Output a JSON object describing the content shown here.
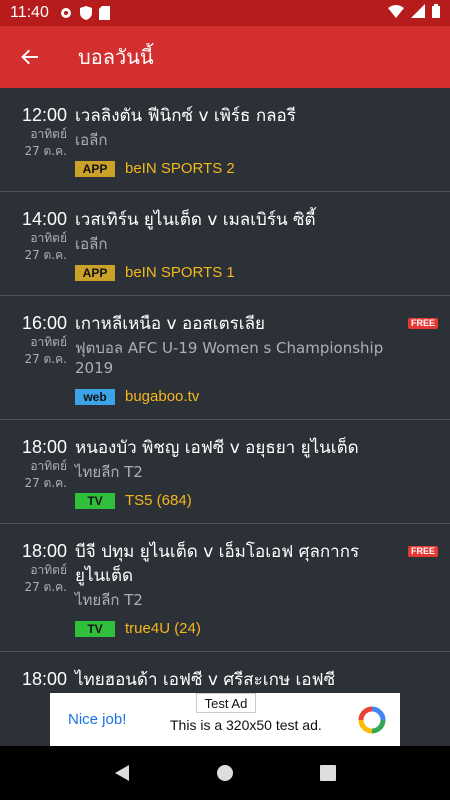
{
  "status_bar": {
    "time": "11:40"
  },
  "app_bar": {
    "title": "บอลวันนี้"
  },
  "matches": [
    {
      "hour": "12:00",
      "day": "อาทิตย์",
      "date": "27 ต.ค.",
      "teams": "เวลลิงตัน ฟีนิกซ์ v เพิร์ธ กลอรี",
      "league": "เอลีก",
      "badge": "APP",
      "badge_type": "app",
      "channel": "beIN SPORTS 2",
      "free": ""
    },
    {
      "hour": "14:00",
      "day": "อาทิตย์",
      "date": "27 ต.ค.",
      "teams": "เวสเทิร์น ยูไนเต็ด v เมลเบิร์น ซิตี้",
      "league": "เอลีก",
      "badge": "APP",
      "badge_type": "app",
      "channel": "beIN SPORTS 1",
      "free": ""
    },
    {
      "hour": "16:00",
      "day": "อาทิตย์",
      "date": "27 ต.ค.",
      "teams": "เกาหลีเหนือ v ออสเตรเลีย",
      "league": "ฟุตบอล AFC U-19 Women s Championship 2019",
      "badge": "web",
      "badge_type": "web",
      "channel": "bugaboo.tv",
      "free": "FREE"
    },
    {
      "hour": "18:00",
      "day": "อาทิตย์",
      "date": "27 ต.ค.",
      "teams": "หนองบัว พิชญ เอฟซี v อยุธยา ยูไนเต็ด",
      "league": "ไทยลีก T2",
      "badge": "TV",
      "badge_type": "tv",
      "channel": "TS5 (684)",
      "free": ""
    },
    {
      "hour": "18:00",
      "day": "อาทิตย์",
      "date": "27 ต.ค.",
      "teams": "บีจี ปทุม ยูไนเต็ด v เอ็มโอเอฟ ศุลกากร ยูไนเต็ด",
      "league": "ไทยลีก T2",
      "badge": "TV",
      "badge_type": "tv",
      "channel": "true4U (24)",
      "free": "FREE"
    },
    {
      "hour": "18:00",
      "day": "",
      "date": "",
      "teams": "ไทยฮอนด้า เอฟซี v ศรีสะเกษ เอฟซี",
      "league": "",
      "badge": "",
      "badge_type": "",
      "channel": "",
      "free": ""
    }
  ],
  "ad": {
    "label": "Test Ad",
    "nice": "Nice job!",
    "text": "This is a 320x50 test ad."
  },
  "colors": {
    "status_bar": "#b71c1c",
    "app_bar": "#d32f2f",
    "background": "#2b3136",
    "channel": "#f5b71c"
  },
  "icons": {
    "back": "arrow-back-icon",
    "nav": [
      "back-triangle-icon",
      "home-circle-icon",
      "recents-square-icon"
    ]
  }
}
